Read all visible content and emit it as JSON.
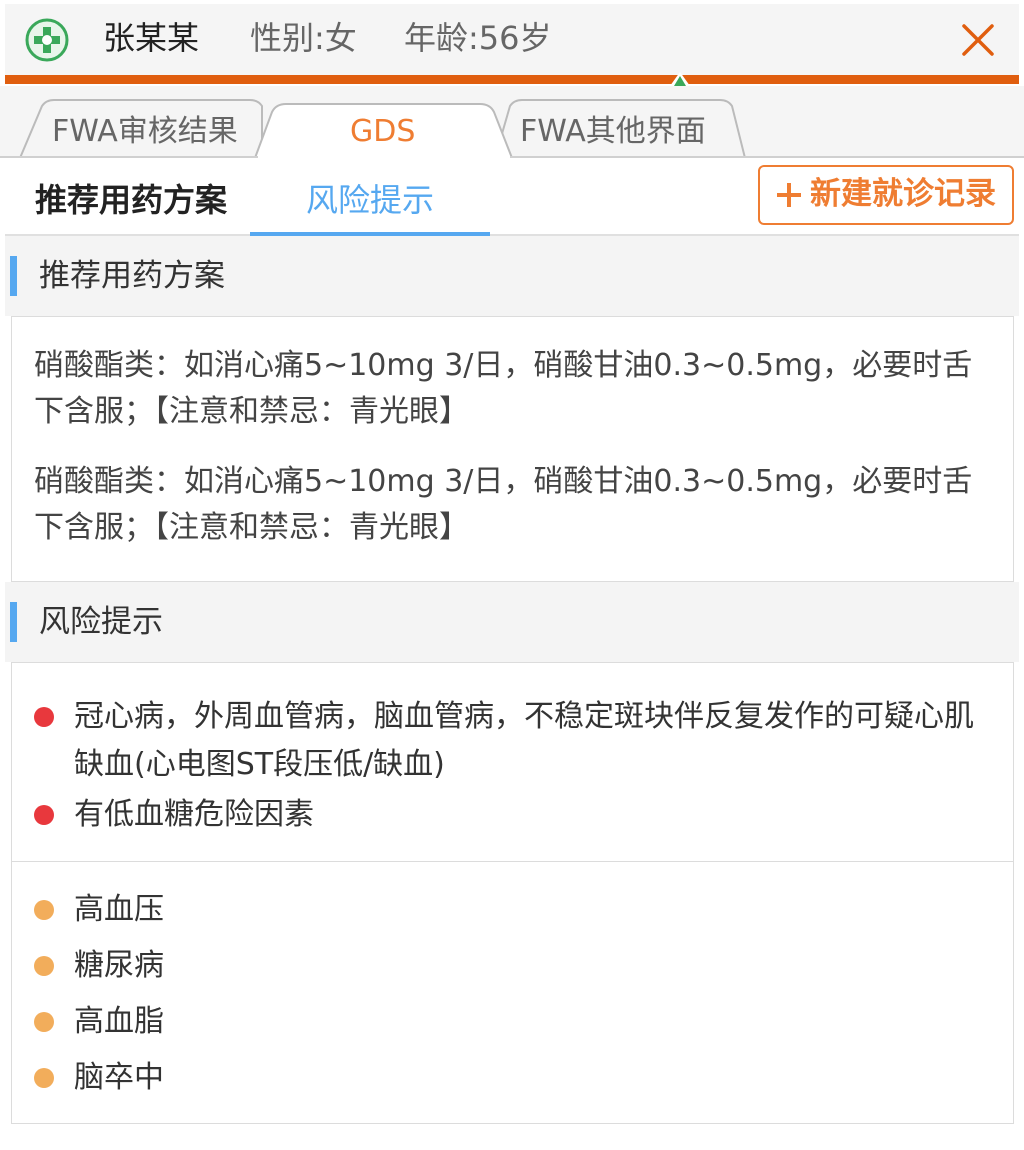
{
  "header": {
    "patient_name": "张某某",
    "gender": "性别:女",
    "age": "年龄:56岁",
    "logo_icon": "hospital-logo-icon",
    "close_icon": "close-icon"
  },
  "top_tabs": [
    {
      "label": "FWA审核结果",
      "active": false
    },
    {
      "label": "GDS",
      "active": true
    },
    {
      "label": "FWA其他界面",
      "active": false
    }
  ],
  "sub_tabs": [
    {
      "label": "推荐用药方案",
      "active": false
    },
    {
      "label": "风险提示",
      "active": true
    }
  ],
  "new_visit_button": "新建就诊记录",
  "plan_section": {
    "title": "推荐用药方案",
    "items": [
      "硝酸酯类：如消心痛5~10mg 3/日，硝酸甘油0.3~0.5mg，必要时舌下含服；【注意和禁忌：青光眼】",
      "硝酸酯类：如消心痛5~10mg 3/日，硝酸甘油0.3~0.5mg，必要时舌下含服；【注意和禁忌：青光眼】"
    ]
  },
  "risk_section": {
    "title": "风险提示",
    "high_risk": [
      "冠心病，外周血管病，脑血管病，不稳定斑块伴反复发作的可疑心肌缺血(心电图ST段压低/缺血)",
      "有低血糖危险因素"
    ],
    "medium_risk": [
      "高血压",
      "糖尿病",
      "高血脂",
      "脑卒中"
    ]
  },
  "colors": {
    "brand_orange": "#e05e0f",
    "accent_orange": "#ef7d32",
    "accent_blue": "#56a8f0",
    "high_risk_red": "#e8383d",
    "medium_risk_orange": "#f2ad5b"
  }
}
